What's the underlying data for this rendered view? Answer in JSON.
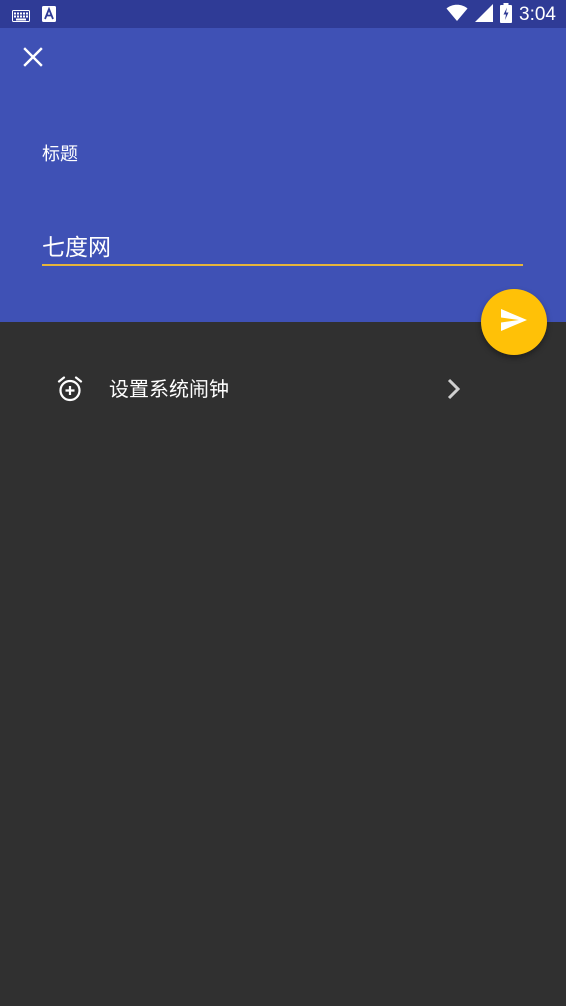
{
  "status_bar": {
    "time": "3:04",
    "icons": [
      "keyboard-icon",
      "text-a-icon",
      "wifi-icon",
      "signal-icon",
      "battery-charging-icon"
    ]
  },
  "header": {
    "close_icon": "close-icon",
    "field_label": "标题",
    "title_value": "七度网",
    "background_color": "#3f51b5",
    "underline_color": "#e6b43a"
  },
  "fab": {
    "icon": "send-icon",
    "color": "#ffc107"
  },
  "list": {
    "items": [
      {
        "icon": "alarm-add-icon",
        "label": "设置系统闹钟",
        "trailing_icon": "chevron-right-icon"
      }
    ]
  }
}
